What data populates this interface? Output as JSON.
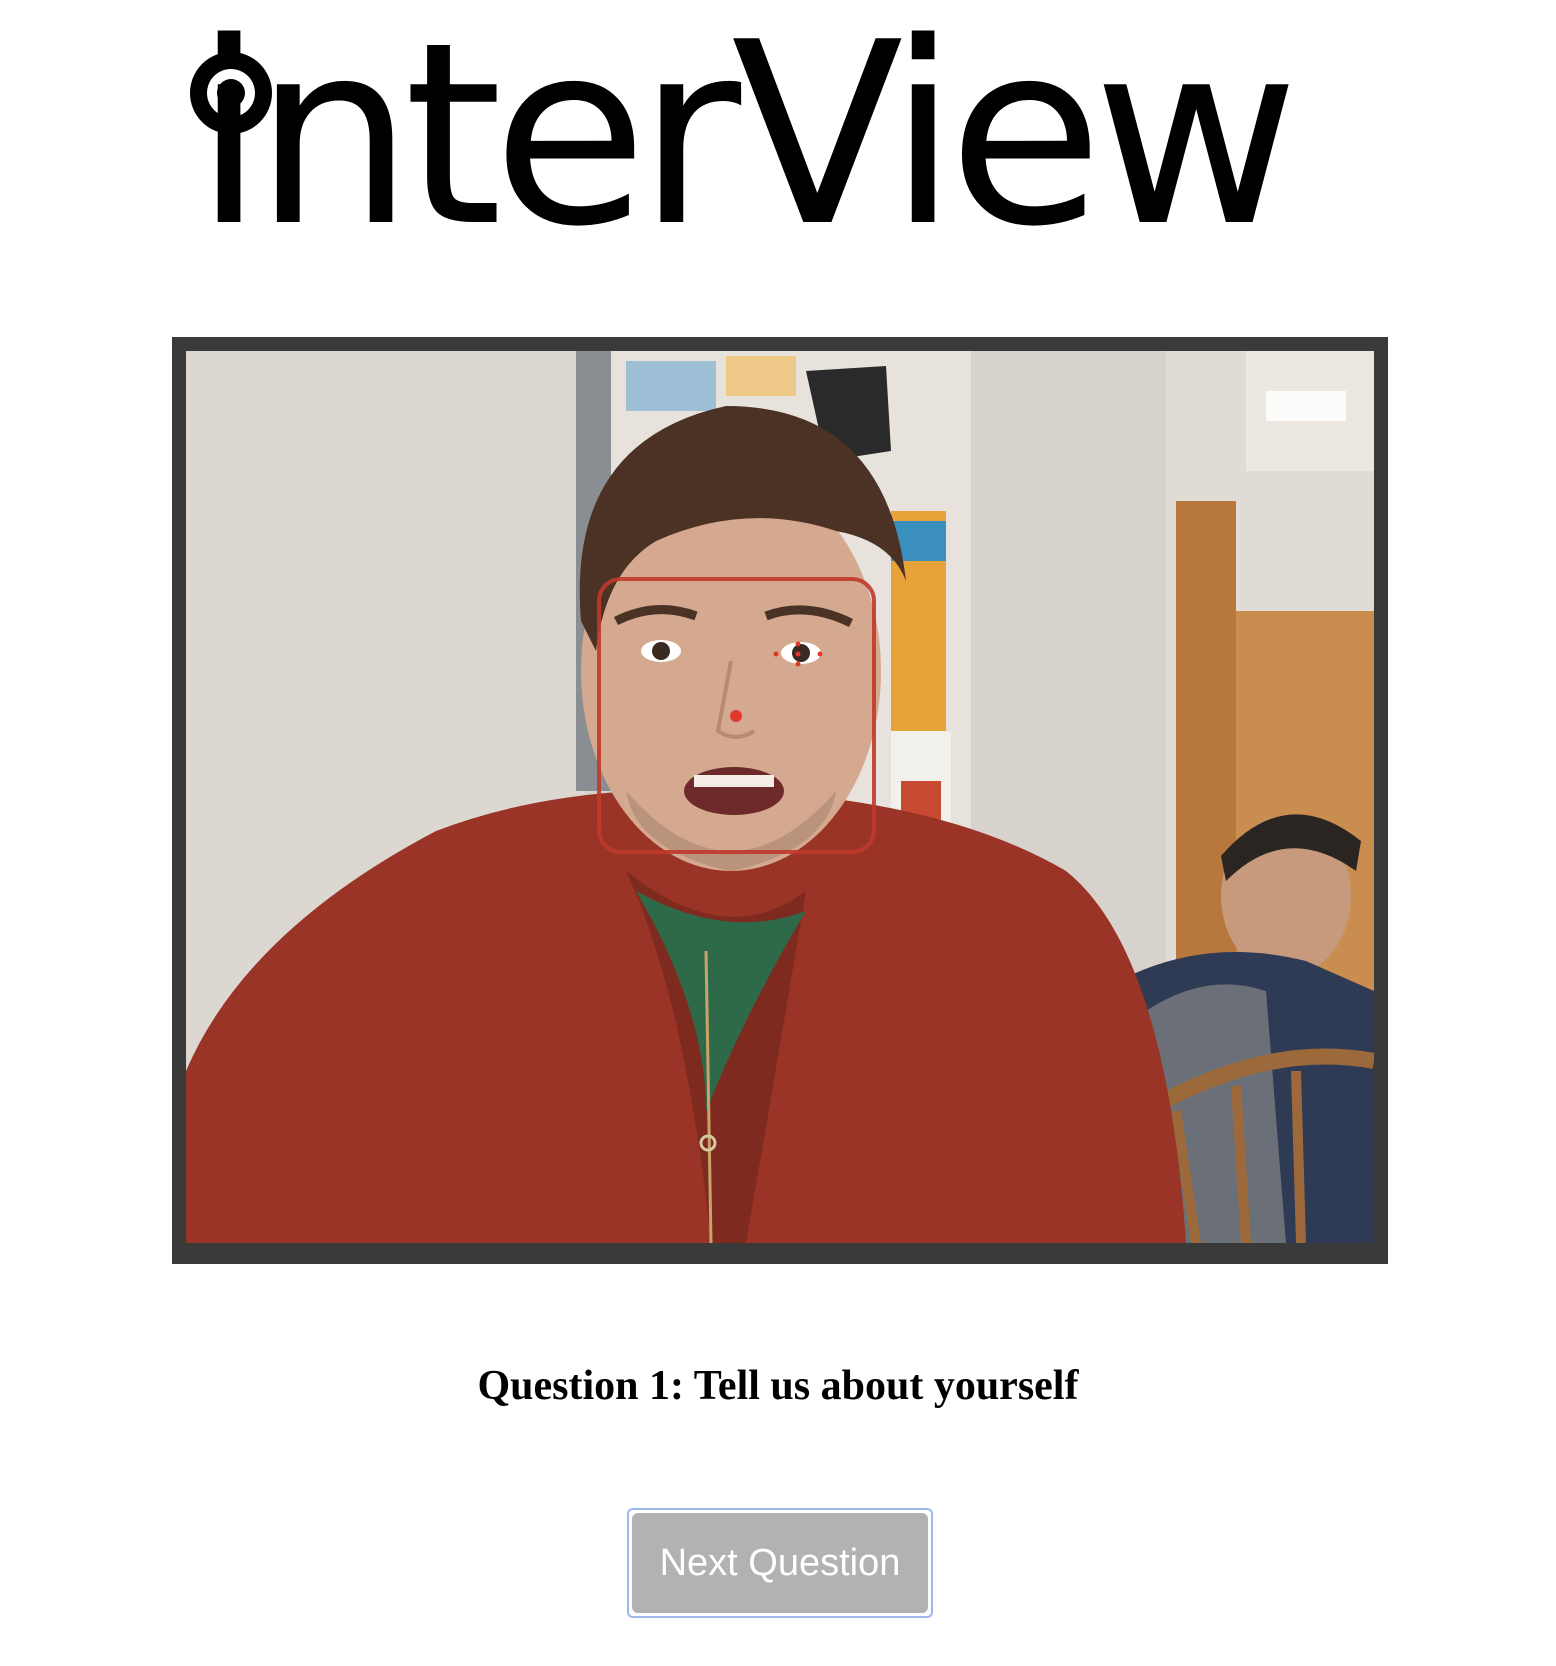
{
  "logo": {
    "text": "interView",
    "icon": "eye-icon"
  },
  "camera": {
    "face_box_color": "#c0392b",
    "landmark_color": "#e03a2c"
  },
  "question": {
    "text": "Question 1: Tell us about yourself"
  },
  "buttons": {
    "next_label": "Next Question"
  },
  "colors": {
    "frame": "#3a3a3a",
    "button_bg": "#b2b2b2",
    "button_text": "#ffffff",
    "focus_ring": "#9cb8ec"
  }
}
